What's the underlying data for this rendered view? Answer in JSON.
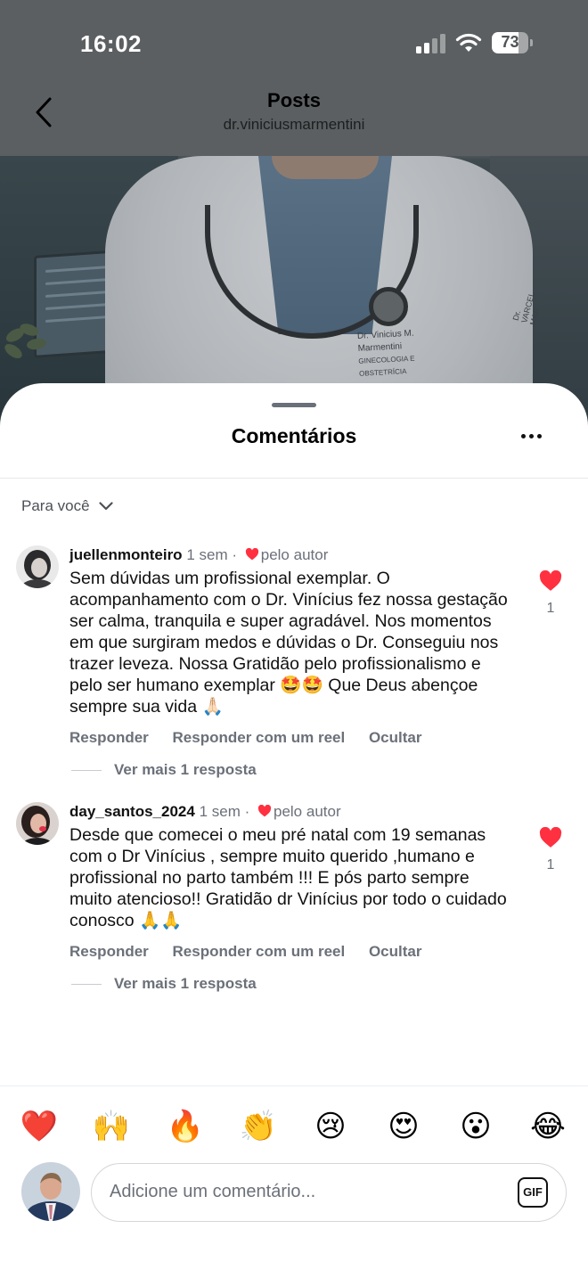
{
  "status_bar": {
    "time": "16:02",
    "battery": "73",
    "battery_level": 0.73
  },
  "header": {
    "title": "Posts",
    "subtitle": "dr.viniciusmarmentini"
  },
  "post_image": {
    "badge_line1": "Dr. Vinicius M. Marmentini",
    "badge_line2": "GINECOLOGIA E OBSTETRÍCIA",
    "sleeve_line1": "Dr.",
    "sleeve_line2": "VARCEL",
    "sleeve_line3": "MAR"
  },
  "sheet": {
    "title": "Comentários",
    "sort_label": "Para você"
  },
  "comments": [
    {
      "username": "juellenmonteiro",
      "time": "1 sem",
      "separator": "·",
      "author_like": "pelo autor",
      "text": "Sem dúvidas um profissional exemplar.  O acompanhamento com o Dr. Vinícius fez nossa gestação ser calma, tranquila e super agradável. Nos momentos em que surgiram medos e dúvidas o Dr. Conseguiu nos trazer leveza.  Nossa Gratidão pelo profissionalismo e pelo ser humano exemplar 🤩🤩 Que Deus abençoe sempre sua vida 🙏🏻",
      "actions": [
        "Responder",
        "Responder com um reel",
        "Ocultar"
      ],
      "more_replies": "Ver mais 1 resposta",
      "like_count": "1"
    },
    {
      "username": "day_santos_2024",
      "time": "1 sem",
      "separator": "·",
      "author_like": "pelo autor",
      "text": "Desde que comecei o meu pré natal com 19 semanas com o Dr Vinícius , sempre muito querido ,humano e profissional no parto também !!! E pós parto sempre muito atencioso!! Gratidão dr Vinícius por todo o cuidado conosco 🙏🙏",
      "actions": [
        "Responder",
        "Responder com um reel",
        "Ocultar"
      ],
      "more_replies": "Ver mais 1 resposta",
      "like_count": "1"
    }
  ],
  "emoji_bar": [
    "❤️",
    "🙌",
    "🔥",
    "👏",
    "😢",
    "😍",
    "😮",
    "😂"
  ],
  "composer": {
    "placeholder": "Adicione um comentário...",
    "gif_label": "GIF"
  },
  "colors": {
    "like_red": "#ff3040",
    "secondary_text": "#6b7079",
    "accent_text": "#111111"
  }
}
